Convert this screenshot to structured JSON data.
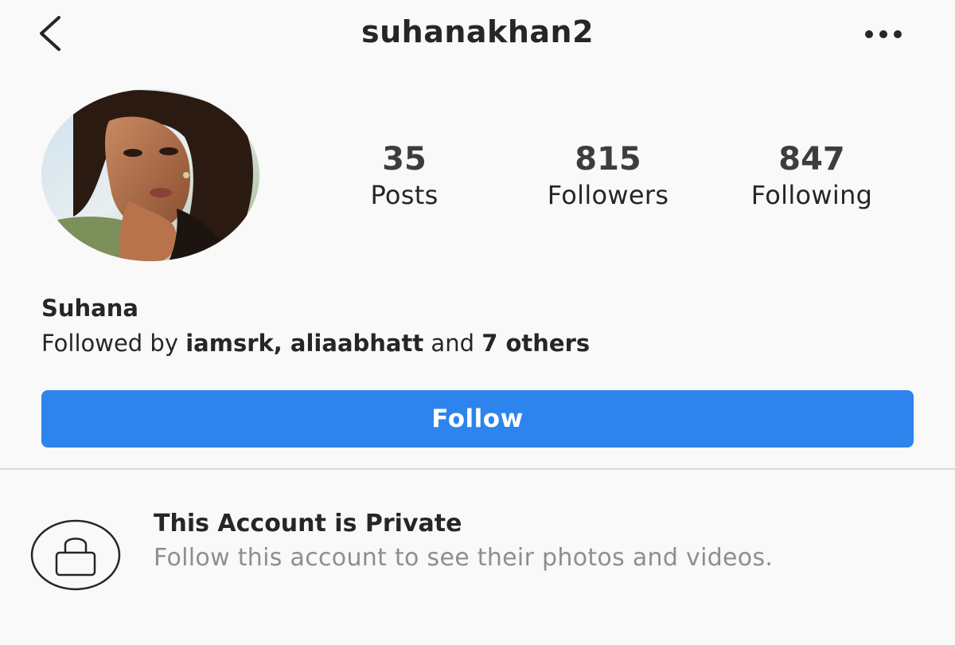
{
  "header": {
    "username": "suhanakhan2",
    "back_icon": "chevron-left-icon",
    "more_icon": "more-horizontal-icon"
  },
  "profile": {
    "avatar_icon": "profile-photo",
    "stats": {
      "posts_count": "35",
      "posts_label": "Posts",
      "followers_count": "815",
      "followers_label": "Followers",
      "following_count": "847",
      "following_label": "Following"
    },
    "display_name": "Suhana",
    "followed_by_prefix": "Followed by ",
    "followed_by_names": "iamsrk, aliaabhatt",
    "followed_by_and": " and ",
    "followed_by_others": "7 others"
  },
  "follow_button": {
    "label": "Follow",
    "color": "#2d84ec"
  },
  "private_notice": {
    "icon": "lock-icon",
    "title": "This Account is Private",
    "text": "Follow this account to see their photos and videos."
  }
}
